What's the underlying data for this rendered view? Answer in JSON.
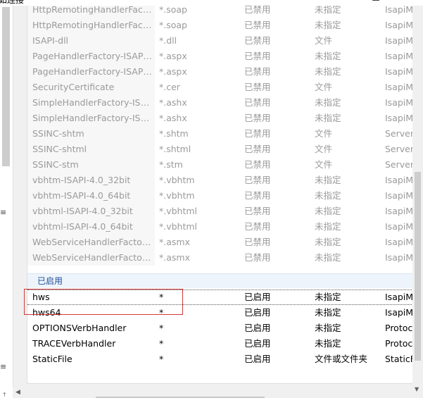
{
  "window": {
    "title_fragment": "如连接",
    "min_glyph": "—",
    "max_glyph": "☐",
    "close_glyph": "✕"
  },
  "left_panel": {
    "glyph_top": "≡",
    "glyph_bottom": "↑"
  },
  "disabled_rows": [
    {
      "name": "HttpRemotingHandlerFacto...",
      "path": "*.soap",
      "state": "已禁用",
      "type": "未指定",
      "handler": "IsapiM"
    },
    {
      "name": "HttpRemotingHandlerFacto...",
      "path": "*.soap",
      "state": "已禁用",
      "type": "未指定",
      "handler": "IsapiM"
    },
    {
      "name": "ISAPI-dll",
      "path": "*.dll",
      "state": "已禁用",
      "type": "文件",
      "handler": "IsapiM"
    },
    {
      "name": "PageHandlerFactory-ISAPI-...",
      "path": "*.aspx",
      "state": "已禁用",
      "type": "未指定",
      "handler": "IsapiM"
    },
    {
      "name": "PageHandlerFactory-ISAPI-...",
      "path": "*.aspx",
      "state": "已禁用",
      "type": "未指定",
      "handler": "IsapiM"
    },
    {
      "name": "SecurityCertificate",
      "path": "*.cer",
      "state": "已禁用",
      "type": "文件",
      "handler": "IsapiM"
    },
    {
      "name": "SimpleHandlerFactory-ISAPI...",
      "path": "*.ashx",
      "state": "已禁用",
      "type": "未指定",
      "handler": "IsapiM"
    },
    {
      "name": "SimpleHandlerFactory-ISAPI...",
      "path": "*.ashx",
      "state": "已禁用",
      "type": "未指定",
      "handler": "IsapiM"
    },
    {
      "name": "SSINC-shtm",
      "path": "*.shtm",
      "state": "已禁用",
      "type": "文件",
      "handler": "ServerS"
    },
    {
      "name": "SSINC-shtml",
      "path": "*.shtml",
      "state": "已禁用",
      "type": "文件",
      "handler": "ServerS"
    },
    {
      "name": "SSINC-stm",
      "path": "*.stm",
      "state": "已禁用",
      "type": "文件",
      "handler": "ServerS"
    },
    {
      "name": "vbhtm-ISAPI-4.0_32bit",
      "path": "*.vbhtm",
      "state": "已禁用",
      "type": "未指定",
      "handler": "IsapiM"
    },
    {
      "name": "vbhtm-ISAPI-4.0_64bit",
      "path": "*.vbhtm",
      "state": "已禁用",
      "type": "未指定",
      "handler": "IsapiM"
    },
    {
      "name": "vbhtml-ISAPI-4.0_32bit",
      "path": "*.vbhtml",
      "state": "已禁用",
      "type": "未指定",
      "handler": "IsapiM"
    },
    {
      "name": "vbhtml-ISAPI-4.0_64bit",
      "path": "*.vbhtml",
      "state": "已禁用",
      "type": "未指定",
      "handler": "IsapiM"
    },
    {
      "name": "WebServiceHandlerFactory-...",
      "path": "*.asmx",
      "state": "已禁用",
      "type": "未指定",
      "handler": "IsapiM"
    },
    {
      "name": "WebServiceHandlerFactory-...",
      "path": "*.asmx",
      "state": "已禁用",
      "type": "未指定",
      "handler": "IsapiM"
    }
  ],
  "enabled_group_label": "已启用",
  "enabled_rows": [
    {
      "name": "hws",
      "path": "*",
      "state": "已启用",
      "type": "未指定",
      "handler": "IsapiM"
    },
    {
      "name": "hws64",
      "path": "*",
      "state": "已启用",
      "type": "未指定",
      "handler": "IsapiM"
    },
    {
      "name": "OPTIONSVerbHandler",
      "path": "*",
      "state": "已启用",
      "type": "未指定",
      "handler": "Protoco"
    },
    {
      "name": "TRACEVerbHandler",
      "path": "*",
      "state": "已启用",
      "type": "未指定",
      "handler": "Protoco"
    },
    {
      "name": "StaticFile",
      "path": "*",
      "state": "已启用",
      "type": "文件或文件夹",
      "handler": "StaticFi"
    }
  ],
  "colors": {
    "highlight_box": "#d03a3a",
    "group_header_text": "#1f4d99",
    "disabled_text": "#9a9a9a"
  }
}
